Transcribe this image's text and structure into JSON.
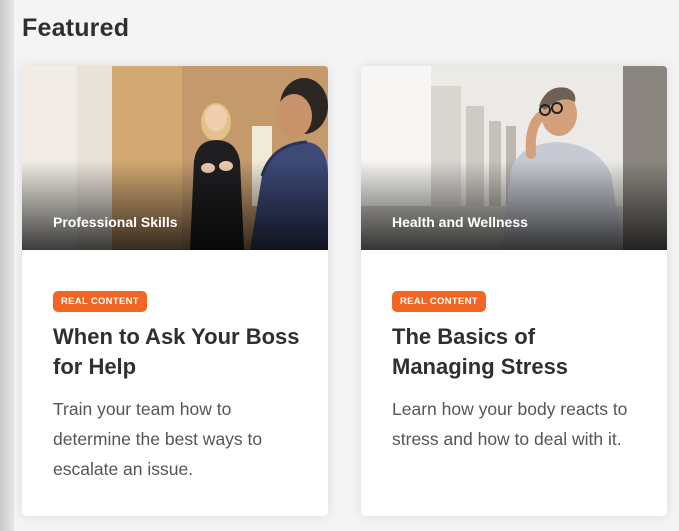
{
  "section": {
    "title": "Featured"
  },
  "cards": [
    {
      "category": "Professional Skills",
      "badge": "REAL CONTENT",
      "title": "When to Ask Your Boss for Help",
      "description": "Train your team how to determine the best ways to escalate an issue."
    },
    {
      "category": "Health and Wellness",
      "badge": "REAL CONTENT",
      "title": "The Basics of Managing Stress",
      "description": "Learn how your body reacts to stress and how to deal with it."
    }
  ],
  "colors": {
    "badge": "#f26522",
    "title_text": "#2f2f2f",
    "body_text": "#555555",
    "background": "#f4f4f4"
  }
}
